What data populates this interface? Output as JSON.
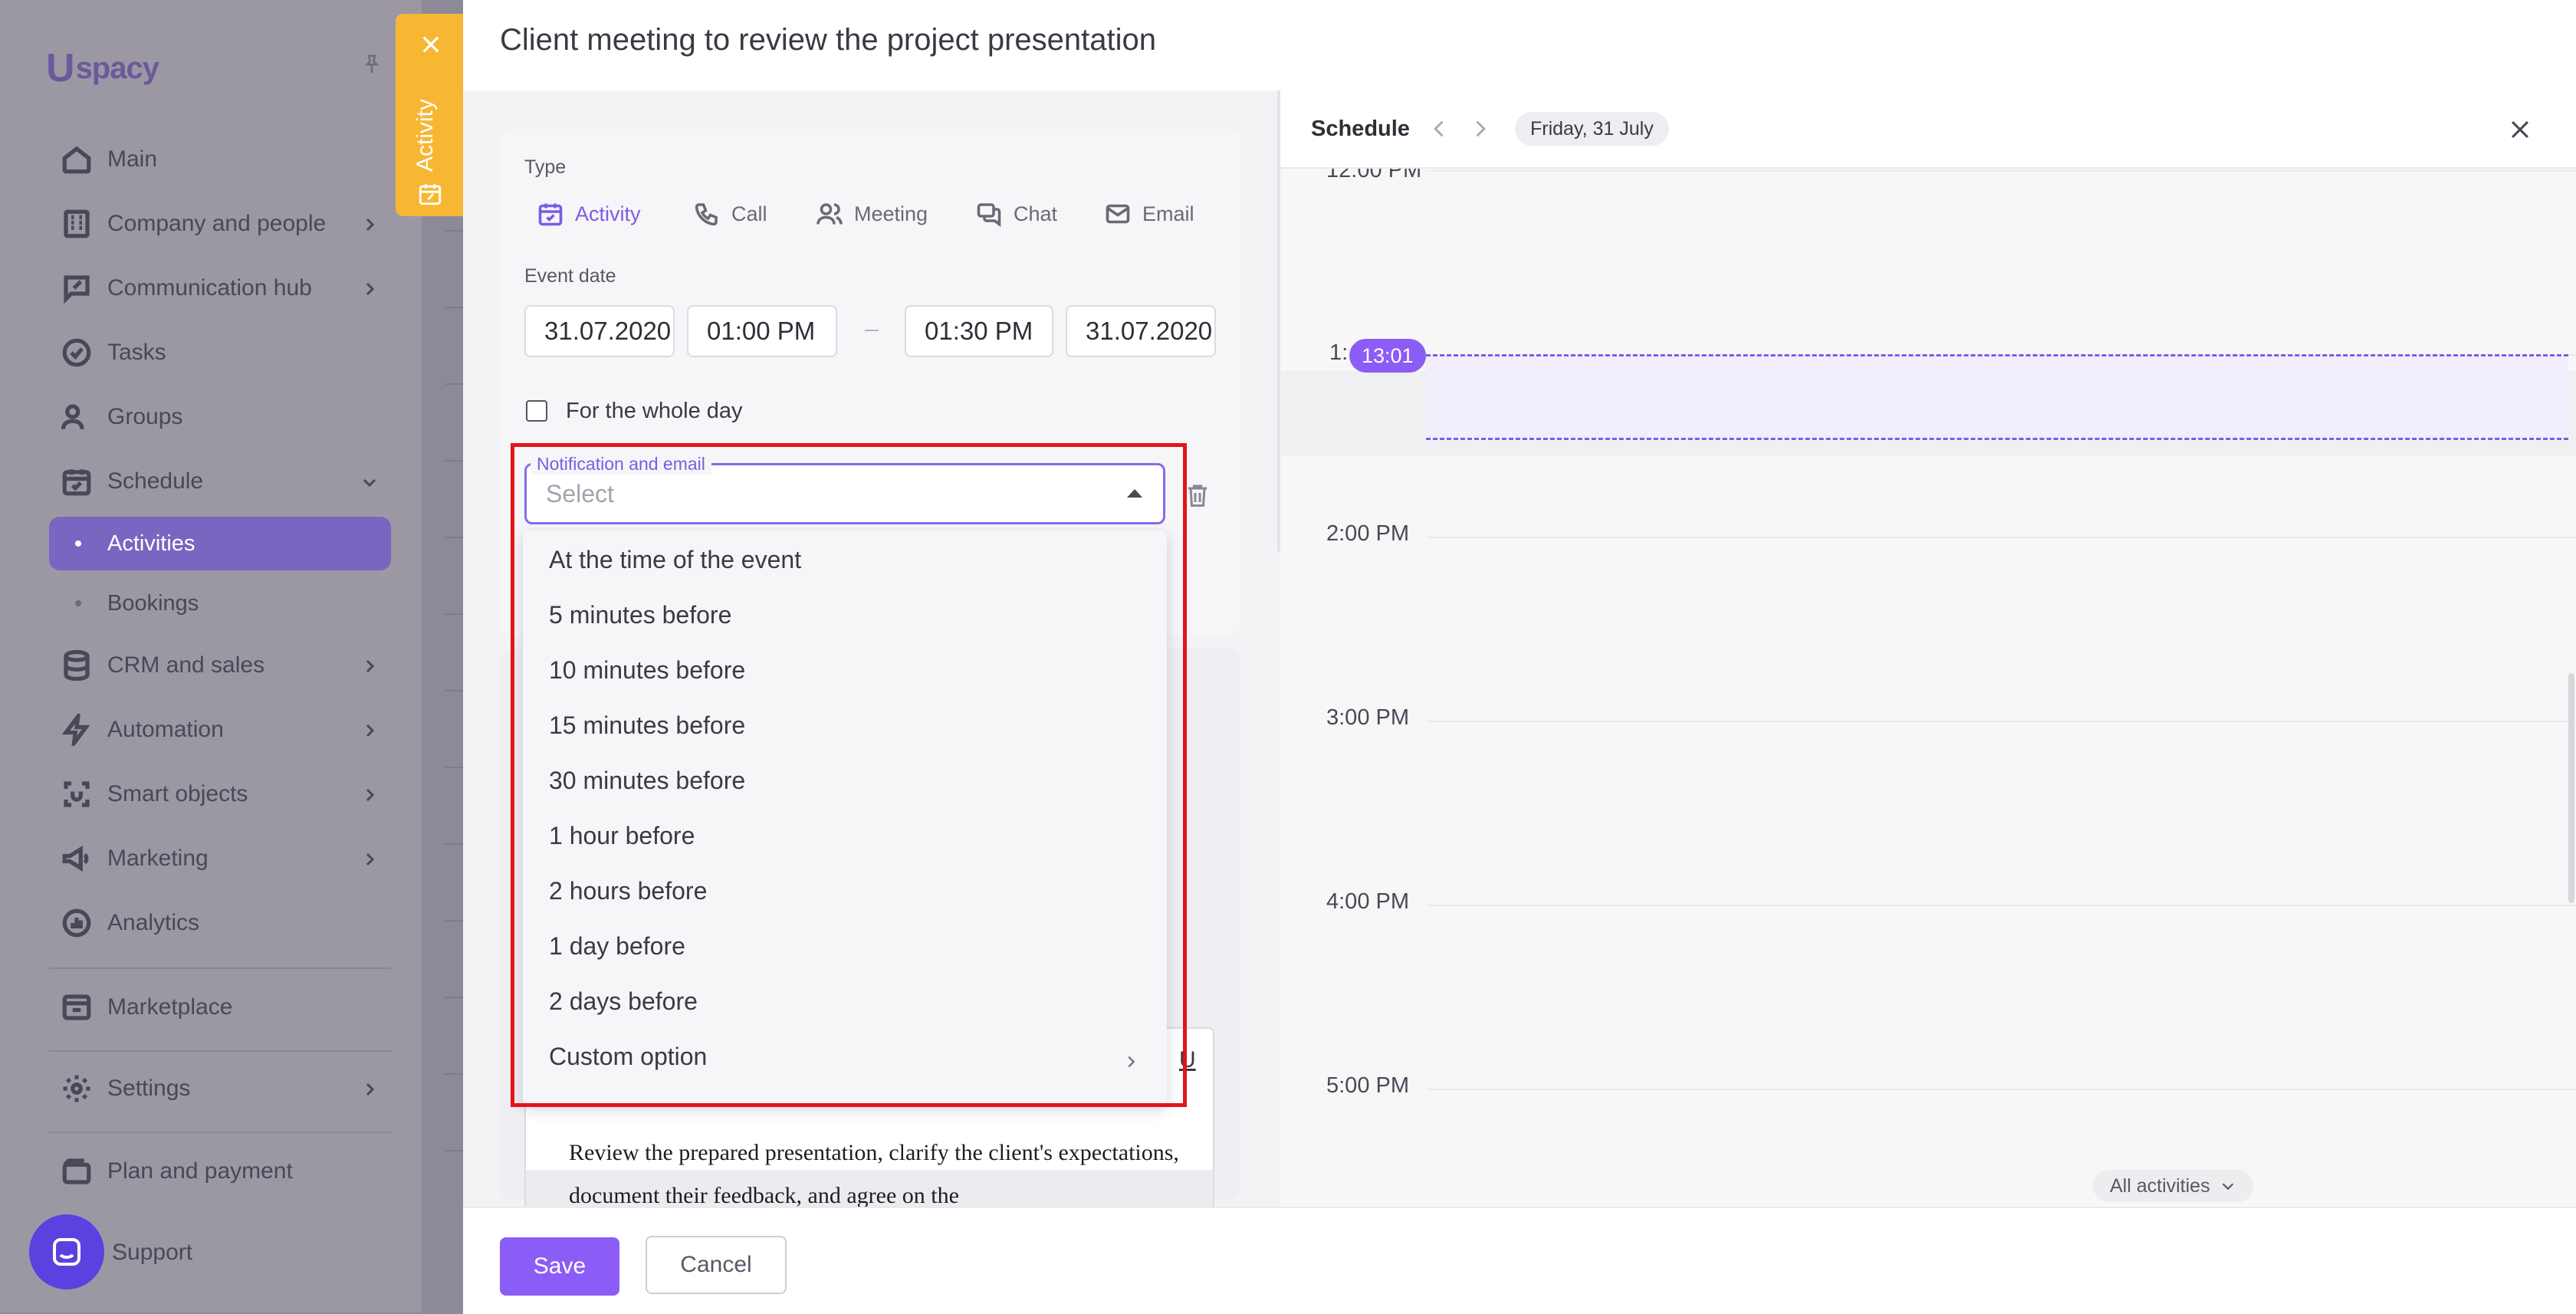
{
  "sidebar": {
    "logo": "spacy",
    "logo_mark": "U",
    "items": [
      {
        "label": "Main",
        "icon": "home-icon",
        "chevron": false
      },
      {
        "label": "Company and people",
        "icon": "building-icon",
        "chevron": true
      },
      {
        "label": "Communication hub",
        "icon": "chat-edit-icon",
        "chevron": true
      },
      {
        "label": "Tasks",
        "icon": "check-circle-icon",
        "chevron": false
      },
      {
        "label": "Groups",
        "icon": "users-icon",
        "chevron": false
      },
      {
        "label": "Schedule",
        "icon": "calendar-icon",
        "chevron": "down"
      },
      {
        "label": "CRM and sales",
        "icon": "database-icon",
        "chevron": true
      },
      {
        "label": "Automation",
        "icon": "lightning-icon",
        "chevron": true
      },
      {
        "label": "Smart objects",
        "icon": "smart-object-icon",
        "chevron": true
      },
      {
        "label": "Marketing",
        "icon": "megaphone-icon",
        "chevron": true
      },
      {
        "label": "Analytics",
        "icon": "chart-icon",
        "chevron": false
      },
      {
        "label": "Marketplace",
        "icon": "store-icon",
        "chevron": false
      },
      {
        "label": "Settings",
        "icon": "gear-icon",
        "chevron": true
      },
      {
        "label": "Plan and payment",
        "icon": "wallet-icon",
        "chevron": false
      },
      {
        "label": "Support",
        "icon": "support-icon",
        "chevron": false
      }
    ],
    "schedule_sub": [
      {
        "label": "Activities",
        "active": true
      },
      {
        "label": "Bookings",
        "active": false
      }
    ]
  },
  "activity_tab": {
    "label": "Activity"
  },
  "panel": {
    "title": "Client meeting to review the project presentation",
    "type_label": "Type",
    "types": [
      {
        "label": "Activity",
        "icon": "calendar-check-icon",
        "active": true
      },
      {
        "label": "Call",
        "icon": "phone-icon",
        "active": false
      },
      {
        "label": "Meeting",
        "icon": "people-icon",
        "active": false
      },
      {
        "label": "Chat",
        "icon": "chat-icon",
        "active": false
      },
      {
        "label": "Email",
        "icon": "mail-icon",
        "active": false
      }
    ],
    "event_date_label": "Event date",
    "start_date": "31.07.2020",
    "start_time": "01:00 PM",
    "end_time": "01:30 PM",
    "end_date": "31.07.2020",
    "whole_day_label": "For the whole day",
    "notification": {
      "legend": "Notification and email",
      "placeholder": "Select",
      "options": [
        "At the time of the event",
        "5 minutes before",
        "10 minutes before",
        "15 minutes before",
        "30 minutes before",
        "1 hour before",
        "2 hours before",
        "1 day before",
        "2 days before",
        "Custom option"
      ]
    },
    "editor": {
      "underline_btn": "U",
      "text": "Review the prepared presentation, clarify the client's expectations, document their feedback, and agree on the"
    },
    "footer": {
      "save": "Save",
      "cancel": "Cancel"
    }
  },
  "schedule": {
    "title": "Schedule",
    "date": "Friday, 31 July",
    "hours": [
      "12:00 PM",
      "2:00 PM",
      "3:00 PM",
      "4:00 PM",
      "5:00 PM"
    ],
    "now_prefix": "1:",
    "now_time": "13:01",
    "filter": "All activities"
  },
  "colors": {
    "accent": "#8b5cf6",
    "highlight_box": "#e3141b",
    "activity_tab": "#f7b733"
  }
}
